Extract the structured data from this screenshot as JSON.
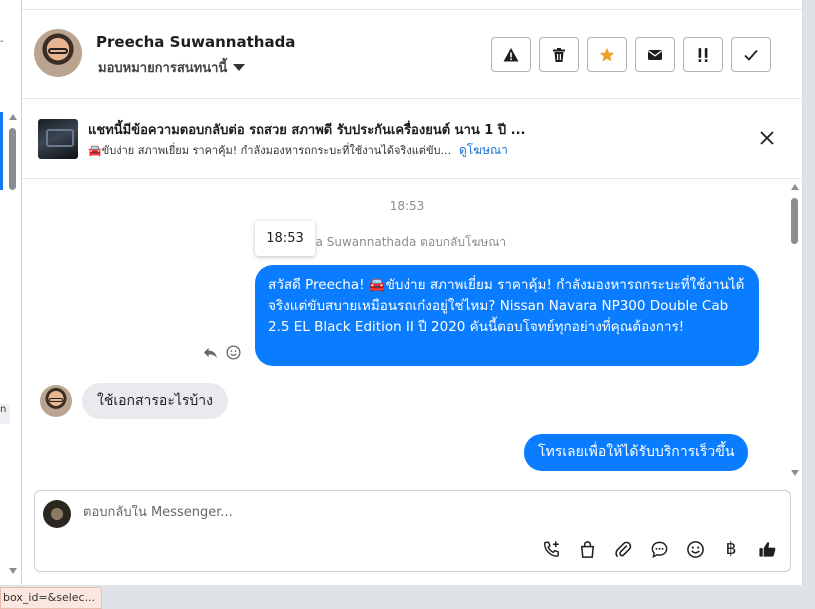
{
  "header": {
    "name": "Preecha Suwannathada",
    "assign_label": "มอบหมายการสนทนานี้"
  },
  "ad": {
    "title": "แชทนี้มีข้อความตอบกลับต่อ รถสวย สภาพดี รับประกันเครื่องยนต์ นาน 1 ปี ...",
    "subtitle": "🚘ขับง่าย สภาพเยี่ยม ราคาคุ้ม! กำลังมองหารถกระบะที่ใช้งานได้จริงแต่ขับ...",
    "link": "ดูโฆษณา"
  },
  "messages": {
    "timestamp": "18:53",
    "tooltip": "18:53",
    "reply_note": "na Suwannathada ตอบกลับโฆษณา",
    "outgoing_1": "สวัสดี Preecha! 🚘ขับง่าย สภาพเยี่ยม ราคาคุ้ม! กำลังมองหารถกระบะที่ใช้งานได้จริงแต่ขับสบายเหมือนรถเก๋งอยู่ใช่ไหม? Nissan Navara NP300 Double Cab 2.5 EL Black Edition II ปี 2020 คันนี้ตอบโจทย์ทุกอย่างที่คุณต้องการ!",
    "incoming_1": "ใช้เอกสารอะไรบ้าง",
    "outgoing_2": "โทรเลยเพื่อให้ได้รับบริการเร็วขึ้น"
  },
  "composer": {
    "placeholder": "ตอบกลับใน Messenger..."
  },
  "status_url": "box_id=&selec...",
  "left_strip": {
    "top_mark": "-",
    "middle_mark": "n"
  },
  "colors": {
    "accent": "#0a7cff",
    "star": "#f0a028",
    "link": "#1a6fd6"
  },
  "icons": {
    "actions": [
      "warning-icon",
      "trash-icon",
      "star-icon",
      "mail-icon",
      "priority-icon",
      "check-icon"
    ],
    "tools": [
      "call-add-icon",
      "shopping-bag-icon",
      "paperclip-icon",
      "chat-bubble-icon",
      "smiley-icon",
      "baht-icon",
      "thumbs-up-icon"
    ]
  }
}
